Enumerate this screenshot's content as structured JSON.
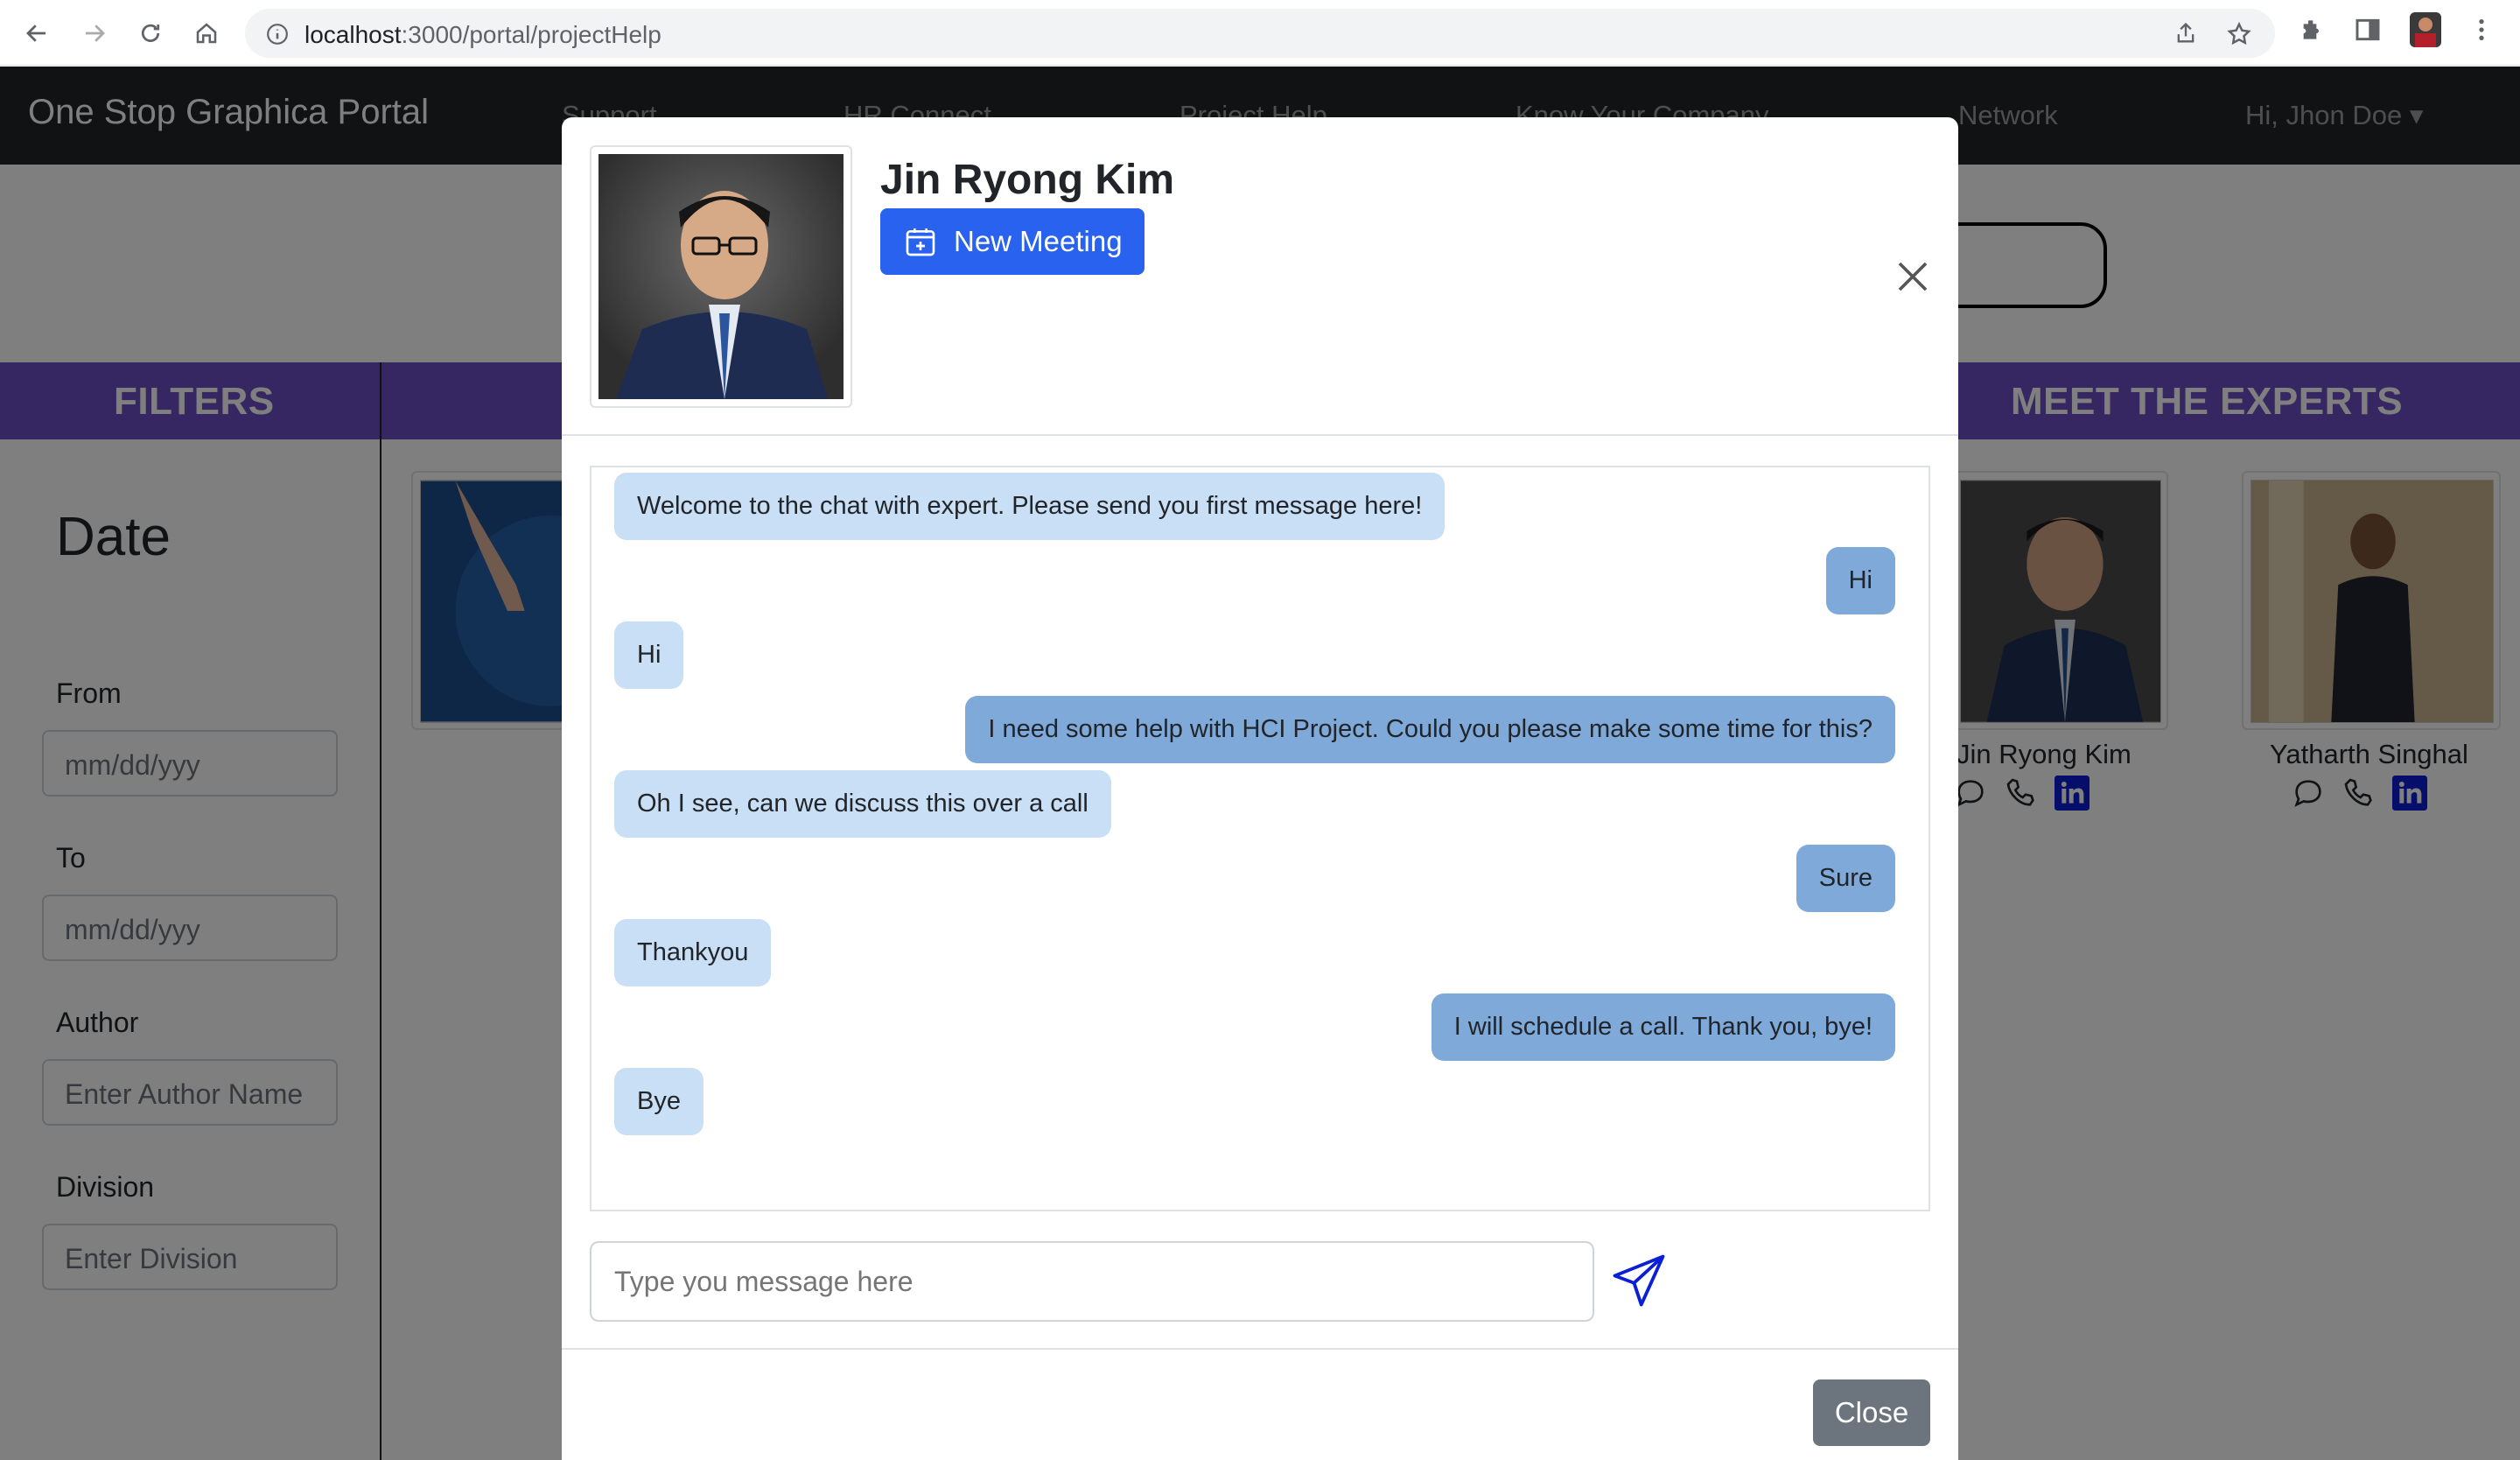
{
  "browser": {
    "url_host": "localhost",
    "url_path": ":3000/portal/projectHelp"
  },
  "navbar": {
    "brand": "One Stop Graphica Portal",
    "links": [
      "Support",
      "HR Connect",
      "Project Help",
      "Know Your Company",
      "Network"
    ],
    "user": "Hi, Jhon Doe"
  },
  "sidebar": {
    "heading": "FILTERS",
    "date_title": "Date",
    "from_label": "From",
    "from_placeholder": "mm/dd/yyy",
    "to_label": "To",
    "to_placeholder": "mm/dd/yyy",
    "author_label": "Author",
    "author_placeholder": "Enter Author Name",
    "division_label": "Division",
    "division_placeholder": "Enter Division"
  },
  "experts": {
    "heading": "MEET THE EXPERTS",
    "list": [
      {
        "name": "Jin Ryong Kim"
      },
      {
        "name": "Yatharth Singhal"
      }
    ]
  },
  "modal": {
    "expert_name": "Jin Ryong Kim",
    "new_meeting_label": "New Meeting",
    "messages": [
      {
        "side": "in",
        "text": "Welcome to the chat with expert. Please send you first message here!"
      },
      {
        "side": "out",
        "text": "Hi"
      },
      {
        "side": "in",
        "text": "Hi"
      },
      {
        "side": "out",
        "text": "I need some help with HCI Project. Could you please make some time for this?"
      },
      {
        "side": "in",
        "text": "Oh I see, can we discuss this over a call"
      },
      {
        "side": "out",
        "text": "Sure"
      },
      {
        "side": "in",
        "text": "Thankyou"
      },
      {
        "side": "out",
        "text": "I will schedule a call. Thank you, bye!"
      },
      {
        "side": "in",
        "text": "Bye"
      }
    ],
    "input_placeholder": "Type you message here",
    "close_label": "Close"
  },
  "colors": {
    "navbar": "#212529",
    "band": "#6c4fc4",
    "primary": "#2962ef",
    "bubble_in": "#c9dff5",
    "bubble_out": "#7ea9d9",
    "secondary": "#6c757d"
  }
}
